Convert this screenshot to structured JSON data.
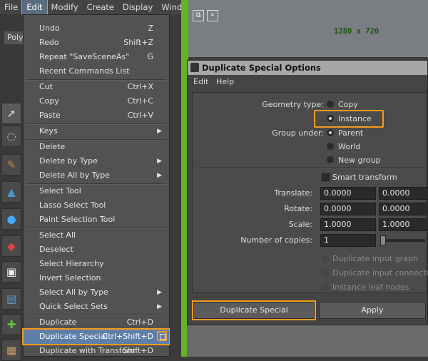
{
  "menubar": {
    "items": [
      "File",
      "Edit",
      "Modify",
      "Create",
      "Display",
      "Window"
    ]
  },
  "left_toolbar": {
    "poly_tab": "Poly"
  },
  "edit_menu": {
    "items": [
      {
        "label": "Undo",
        "shortcut": "Z"
      },
      {
        "label": "Redo",
        "shortcut": "Shift+Z"
      },
      {
        "label": "Repeat \"SaveSceneAs\"",
        "shortcut": "G"
      },
      {
        "label": "Recent Commands List",
        "shortcut": ""
      },
      {
        "label": "Cut",
        "shortcut": "Ctrl+X"
      },
      {
        "label": "Copy",
        "shortcut": "Ctrl+C"
      },
      {
        "label": "Paste",
        "shortcut": "Ctrl+V"
      },
      {
        "label": "Keys",
        "shortcut": ""
      },
      {
        "label": "Delete",
        "shortcut": ""
      },
      {
        "label": "Delete by Type",
        "shortcut": ""
      },
      {
        "label": "Delete All by Type",
        "shortcut": ""
      },
      {
        "label": "Select Tool",
        "shortcut": ""
      },
      {
        "label": "Lasso Select Tool",
        "shortcut": ""
      },
      {
        "label": "Paint Selection Tool",
        "shortcut": ""
      },
      {
        "label": "Select All",
        "shortcut": ""
      },
      {
        "label": "Deselect",
        "shortcut": ""
      },
      {
        "label": "Select Hierarchy",
        "shortcut": ""
      },
      {
        "label": "Invert Selection",
        "shortcut": ""
      },
      {
        "label": "Select All by Type",
        "shortcut": ""
      },
      {
        "label": "Quick Select Sets",
        "shortcut": ""
      },
      {
        "label": "Duplicate",
        "shortcut": "Ctrl+D"
      },
      {
        "label": "Duplicate Special",
        "shortcut": "Ctrl+Shift+D"
      },
      {
        "label": "Duplicate with Transform",
        "shortcut": "Shift+D"
      }
    ]
  },
  "viewport": {
    "resolution": "1280 x 720"
  },
  "dialog": {
    "title": "Duplicate Special Options",
    "menu": [
      "Edit",
      "Help"
    ],
    "geometry_type_label": "Geometry type:",
    "geometry_options": [
      "Copy",
      "Instance"
    ],
    "geometry_selected": "Instance",
    "group_under_label": "Group under:",
    "group_options": [
      "Parent",
      "World",
      "New group"
    ],
    "group_selected": "Parent",
    "smart_transform": "Smart transform",
    "translate_label": "Translate:",
    "translate": [
      "0.0000",
      "0.0000"
    ],
    "rotate_label": "Rotate:",
    "rotate": [
      "0.0000",
      "0.0000"
    ],
    "scale_label": "Scale:",
    "scale": [
      "1.0000",
      "1.0000"
    ],
    "copies_label": "Number of copies:",
    "copies": "1",
    "duplicate_input_graph": "Duplicate input graph",
    "duplicate_input_connections": "Duplicate input connections",
    "instance_leaf_nodes": "Instance leaf nodes",
    "btn_duplicate": "Duplicate Special",
    "btn_apply": "Apply"
  },
  "colors": {
    "highlight": "#f39a20",
    "accent_green": "#63b521",
    "menu_selection": "#5d7fa8"
  }
}
